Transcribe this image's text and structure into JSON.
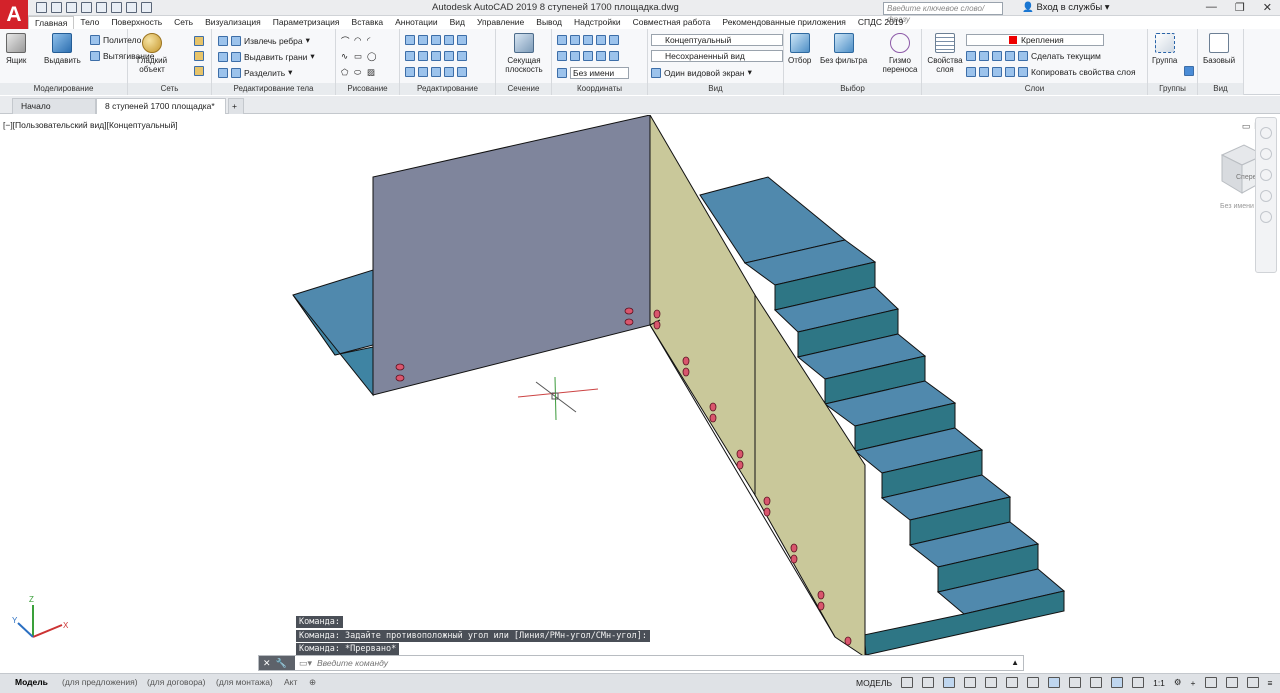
{
  "app": {
    "logo_letter": "A",
    "title": "Autodesk AutoCAD 2019    8 ступеней 1700 площадка.dwg",
    "search_placeholder": "Введите ключевое слово/фразу",
    "signin": "Вход в службы",
    "win_controls": [
      "—",
      "❐",
      "✕"
    ],
    "accent": "#d3222a"
  },
  "menu_tabs": [
    "Главная",
    "Тело",
    "Поверхность",
    "Сеть",
    "Визуализация",
    "Параметризация",
    "Вставка",
    "Аннотации",
    "Вид",
    "Управление",
    "Вывод",
    "Надстройки",
    "Совместная работа",
    "Рекомендованные приложения",
    "СПДС 2019"
  ],
  "ribbon": {
    "modeling": {
      "label": "Моделирование",
      "box": "Ящик",
      "extrude": "Выдавить",
      "polysolid": "Политело",
      "presspull": "Вытягивание"
    },
    "mesh": {
      "label": "Сеть",
      "smooth_object": "Гладкий объект"
    },
    "solid_edit": {
      "label": "Редактирование тела",
      "extract_edges": "Извлечь ребра",
      "extrude_faces": "Выдавить грани",
      "separate": "Разделить"
    },
    "draw": {
      "label": "Рисование"
    },
    "modify": {
      "label": "Редактирование"
    },
    "section": {
      "label": "Сечение",
      "section_plane": "Секущая плоскость"
    },
    "coordinates": {
      "label": "Координаты",
      "unnamed": "Без имени"
    },
    "view": {
      "label": "Вид",
      "visual_style": "Концептуальный",
      "saved_view": "Несохраненный вид",
      "viewport_config": "Один видовой экран"
    },
    "selection": {
      "label": "Выбор",
      "culling": "Отбор",
      "no_filter": "Без фильтра",
      "gizmo": "Гизмо переноса"
    },
    "layers": {
      "label": "Слои",
      "layer_props": "Свойства слоя",
      "current_layer": "Крепления",
      "make_current": "Сделать текущим",
      "match_layer": "Копировать свойства слоя"
    },
    "groups": {
      "label": "Группы",
      "group": "Группа"
    },
    "view2": {
      "label": "Вид",
      "base": "Базовый"
    }
  },
  "doc_tabs": [
    "Начало",
    "8 ступеней 1700 площадка*"
  ],
  "viewport": {
    "label": "[−][Пользовательский вид][Концептуальный]",
    "viewcube_face": "Спереди",
    "wcs_menu": "Без имени",
    "axes": {
      "x": "X",
      "y": "Y",
      "z": "Z"
    }
  },
  "command": {
    "history": [
      "Команда:",
      "Команда: Задайте противоположный угол или [Линия/РМн-угол/СМн-угол]:",
      "Команда: *Прервано*"
    ],
    "placeholder": "Введите команду"
  },
  "status": {
    "layouts": [
      "Модель",
      "(для предложения)",
      "(для договора)",
      "(для монтажа)",
      "Акт"
    ],
    "space": "МОДЕЛЬ",
    "scale": "1:1"
  },
  "colors": {
    "stair_top": "#5089ad",
    "stair_riser": "#2e7685",
    "wall_gray": "#7f859c",
    "wall_beige": "#c9c89a",
    "fastener": "#d9566d"
  }
}
